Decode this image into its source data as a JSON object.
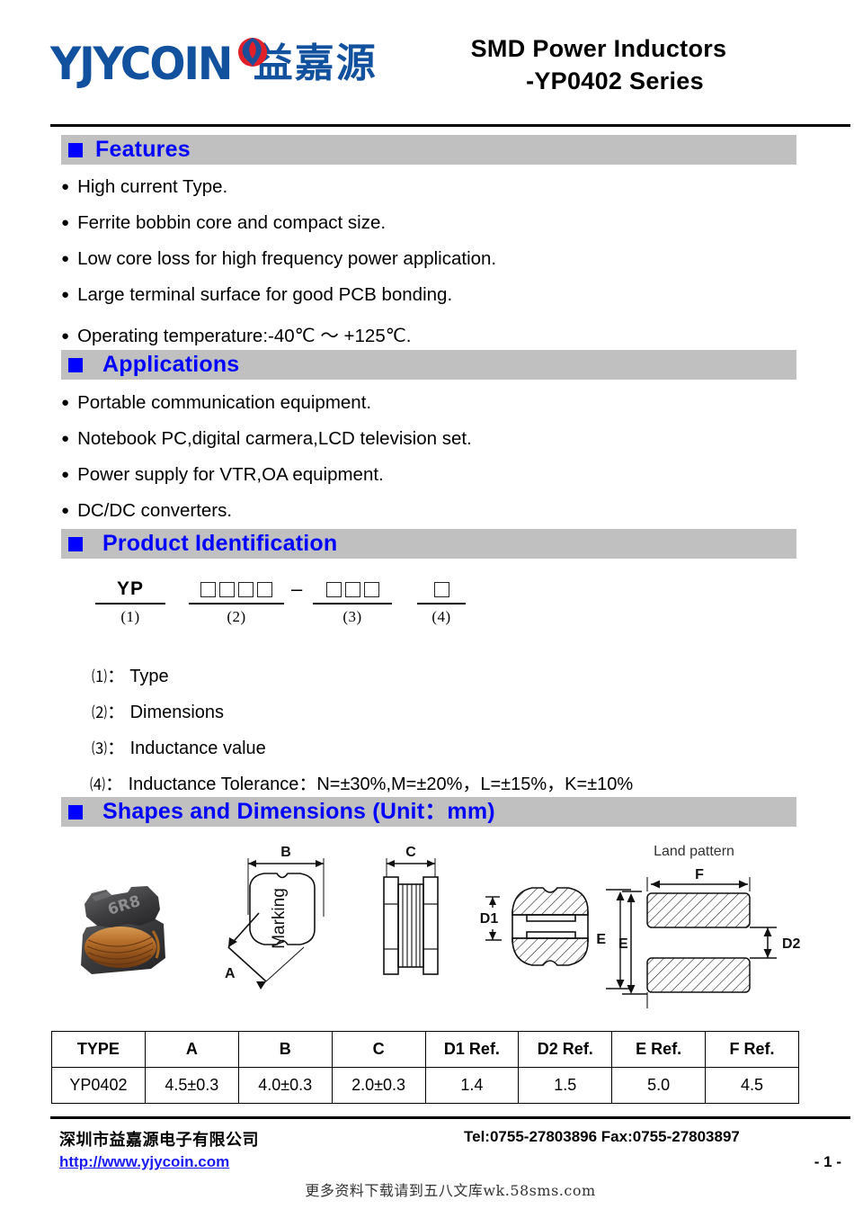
{
  "header": {
    "logo_text": "YJYCOIN",
    "logo_cn": "益嘉源",
    "title_line1": "SMD Power Inductors",
    "title_line2": "-YP0402 Series",
    "logo_blue": "#12519e",
    "logo_red": "#e2202a"
  },
  "sections": {
    "features": {
      "title": "Features",
      "items": [
        "High current Type.",
        "Ferrite bobbin core and compact size.",
        "Low core loss for high frequency power application.",
        "Large terminal surface for good PCB bonding.",
        "Operating temperature:-40℃ ～ +125℃."
      ]
    },
    "applications": {
      "title": "Applications",
      "items": [
        "Portable communication equipment.",
        "Notebook PC,digital carmera,LCD television set.",
        "Power supply for VTR,OA equipment.",
        "DC/DC converters."
      ]
    },
    "product_identification": {
      "title": "Product Identification",
      "diagram": {
        "part1_label": "YP",
        "part1_num": "(1)",
        "part2_boxes": 4,
        "part2_num": "(2)",
        "separator": "–",
        "part3_boxes": 3,
        "part3_num": "(3)",
        "part4_boxes": 1,
        "part4_num": "(4)"
      },
      "legend": [
        {
          "idx": "⑴",
          "sep": "：",
          "text": "Type"
        },
        {
          "idx": "⑵",
          "sep": "：",
          "text": "Dimensions"
        },
        {
          "idx": "⑶",
          "sep": "：",
          "text": "Inductance value"
        },
        {
          "idx": "⑷",
          "sep": "：",
          "text": "Inductance Tolerance：N=±30%,M=±20%，L=±15%，K=±10%"
        }
      ]
    },
    "shapes": {
      "title": "Shapes and Dimensions (Unit：mm)",
      "drawing_labels": {
        "marking": "Marking",
        "a": "A",
        "b": "B",
        "c": "C",
        "d1": "D1",
        "d2": "D2",
        "e_left": "E",
        "e_right": "E",
        "f": "F",
        "land_pattern": "Land pattern",
        "photo_marking": "6R8"
      }
    }
  },
  "table": {
    "headers": [
      "TYPE",
      "A",
      "B",
      "C",
      "D1 Ref.",
      "D2 Ref.",
      "E Ref.",
      "F Ref."
    ],
    "rows": [
      [
        "YP0402",
        "4.5±0.3",
        "4.0±0.3",
        "2.0±0.3",
        "1.4",
        "1.5",
        "5.0",
        "4.5"
      ]
    ]
  },
  "footer": {
    "company": "深圳市益嘉源电子有限公司",
    "contact": "Tel:0755-27803896   Fax:0755-27803897",
    "url": "http://www.yjycoin.com",
    "page": "- 1 -",
    "watermark": "更多资料下载请到五八文库wk.58sms.com"
  }
}
